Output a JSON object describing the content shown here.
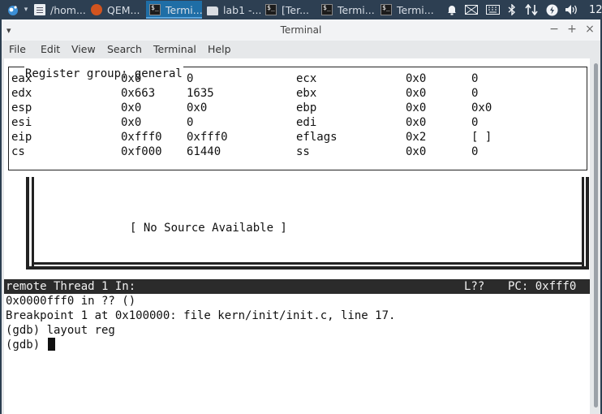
{
  "taskbar": {
    "items": [
      {
        "label": "/hom..."
      },
      {
        "label": "QEM..."
      },
      {
        "label": "Termi..."
      },
      {
        "label": "lab1 -..."
      },
      {
        "label": "[Ter..."
      },
      {
        "label": "Termi..."
      },
      {
        "label": "Termi..."
      }
    ],
    "clock": "12"
  },
  "window": {
    "title": "Terminal",
    "buttons": {
      "minimize": "−",
      "maximize": "+",
      "close": "×"
    }
  },
  "menu": [
    "File",
    "Edit",
    "View",
    "Search",
    "Terminal",
    "Help"
  ],
  "registers": {
    "group_title": "Register group: general",
    "rows": [
      {
        "l_name": "eax",
        "l_hex": "0x0",
        "l_val": "0",
        "r_name": "ecx",
        "r_hex": "0x0",
        "r_val": "0"
      },
      {
        "l_name": "edx",
        "l_hex": "0x663",
        "l_val": "1635",
        "r_name": "ebx",
        "r_hex": "0x0",
        "r_val": "0"
      },
      {
        "l_name": "esp",
        "l_hex": "0x0",
        "l_val": "0x0",
        "r_name": "ebp",
        "r_hex": "0x0",
        "r_val": "0x0"
      },
      {
        "l_name": "esi",
        "l_hex": "0x0",
        "l_val": "0",
        "r_name": "edi",
        "r_hex": "0x0",
        "r_val": "0"
      },
      {
        "l_name": "eip",
        "l_hex": "0xfff0",
        "l_val": "0xfff0",
        "r_name": "eflags",
        "r_hex": "0x2",
        "r_val": "[ ]"
      },
      {
        "l_name": "cs",
        "l_hex": "0xf000",
        "l_val": "61440",
        "r_name": "ss",
        "r_hex": "0x0",
        "r_val": "0"
      }
    ]
  },
  "source": {
    "no_source": "[ No Source Available ]"
  },
  "status": {
    "left": "remote Thread 1 In:",
    "line": "L??",
    "pc": "PC: 0xfff0"
  },
  "console": {
    "lines": [
      "0x0000fff0 in ?? ()",
      "Breakpoint 1 at 0x100000: file kern/init/init.c, line 17.",
      "(gdb) layout reg",
      "(gdb) "
    ]
  }
}
